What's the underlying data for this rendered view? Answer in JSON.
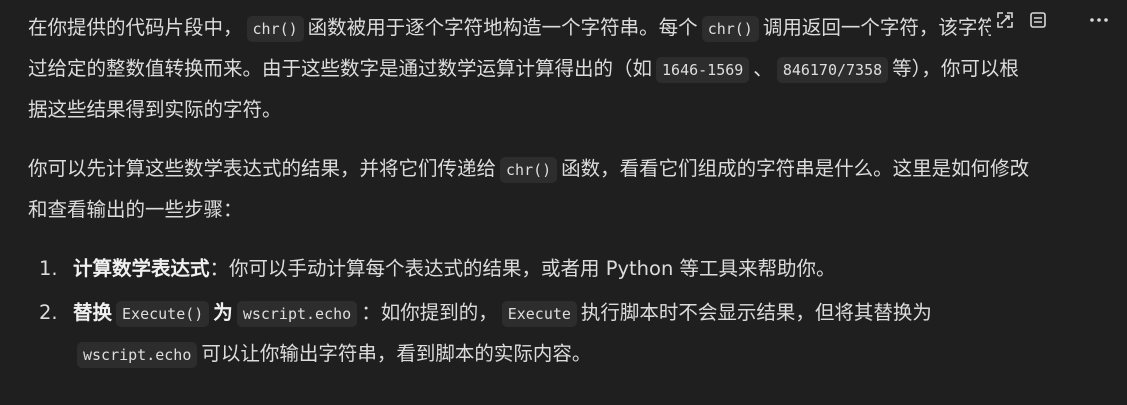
{
  "paragraph1": {
    "t1": "在你提供的代码片段中，",
    "c1": "chr()",
    "t2": "函数被用于逐个字符地构造一个字符串。每个",
    "c2": "chr()",
    "t3": "调用返回一个字符，该字符是通过给定的整数值转换而来。由于这些数字是通过数学运算计算得出的（如",
    "c3": "1646-1569",
    "t4": "、",
    "c4": "846170/7358",
    "t5": "等），你可以根据这些结果得到实际的字符。"
  },
  "paragraph2": {
    "t1": "你可以先计算这些数学表达式的结果，并将它们传递给",
    "c1": "chr()",
    "t2": "函数，看看它们组成的字符串是什么。这里是如何修改和查看输出的一些步骤："
  },
  "steps": [
    {
      "num": "1.",
      "bold": "计算数学表达式",
      "text": "：你可以手动计算每个表达式的结果，或者用 Python 等工具来帮助你。"
    },
    {
      "num": "2.",
      "bold1": "替换",
      "code1": "Execute()",
      "bold2": "为",
      "code2": "wscript.echo",
      "text1": "：如你提到的，",
      "code3": "Execute",
      "text2": "执行脚本时不会显示结果，但将其替换为",
      "code4": "wscript.echo",
      "text3": "可以让你输出字符串，看到脚本的实际内容。"
    }
  ],
  "toolbar": {
    "icons": [
      "expand-icon",
      "list-icon",
      "more-icon"
    ]
  }
}
